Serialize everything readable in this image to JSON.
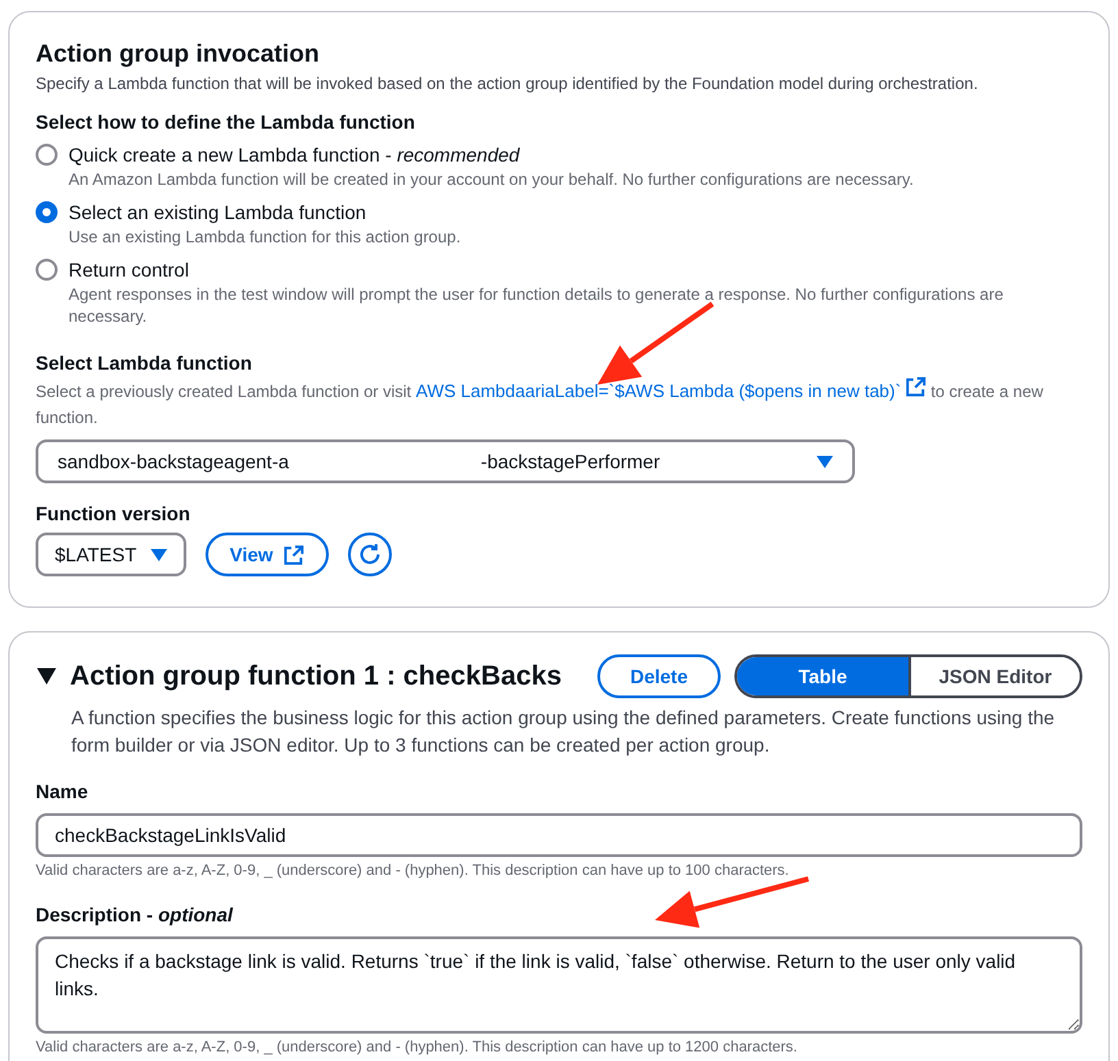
{
  "invocation": {
    "title": "Action group invocation",
    "description": "Specify a Lambda function that will be invoked based on the action group identified by the Foundation model during orchestration.",
    "method_label": "Select how to define the Lambda function",
    "options": [
      {
        "label": "Quick create a new Lambda function - *recommended*",
        "description": "An Amazon Lambda function will be created in your account on your behalf. No further configurations are necessary.",
        "selected": false
      },
      {
        "label": "Select an existing Lambda function",
        "description": "Use an existing Lambda function for this action group.",
        "selected": true
      },
      {
        "label": "Return control",
        "description": "Agent responses in the test window will prompt the user for function details to generate a response. No further configurations are necessary.",
        "selected": false
      }
    ],
    "lambda": {
      "label": "Select Lambda function",
      "hint_before": "Select a previously created Lambda function or visit",
      "link": "AWS LambdaariaLabel=`$AWS Lambda ($opens in new tab)`",
      "hint_after": "to create a new function.",
      "value_start": "sandbox-backstageagent-a",
      "value_end": "-backstagePerformer"
    },
    "version": {
      "label": "Function version",
      "value": "$LATEST",
      "view": "View"
    }
  },
  "function": {
    "expanded": true,
    "title": "Action group function 1 : checkBacks",
    "delete": "Delete",
    "modes": [
      {
        "label": "Table",
        "selected": true
      },
      {
        "label": "JSON Editor",
        "selected": false
      }
    ],
    "description": "A function specifies the business logic for this action group using the defined parameters. Create functions using the form builder or via JSON editor. Up to 3 functions can be created per action group.",
    "name": {
      "label": "Name",
      "value": "checkBackstageLinkIsValid",
      "hint": "Valid characters are a-z, A-Z, 0-9, _ (underscore) and - (hyphen). This description can have up to 100 characters."
    },
    "desc_field": {
      "label": "Description - *optional*",
      "value": "Checks if a backstage link is valid. Returns `true` if the link is valid, `false` otherwise. Return to the user only valid links.",
      "hint": "Valid characters are a-z, A-Z, 0-9, _ (underscore) and - (hyphen). This description can have up to 1200 characters."
    }
  },
  "annotations": [
    {
      "kind": "arrow",
      "color": "#ff2a14"
    },
    {
      "kind": "arrow",
      "color": "#ff2a14"
    }
  ]
}
